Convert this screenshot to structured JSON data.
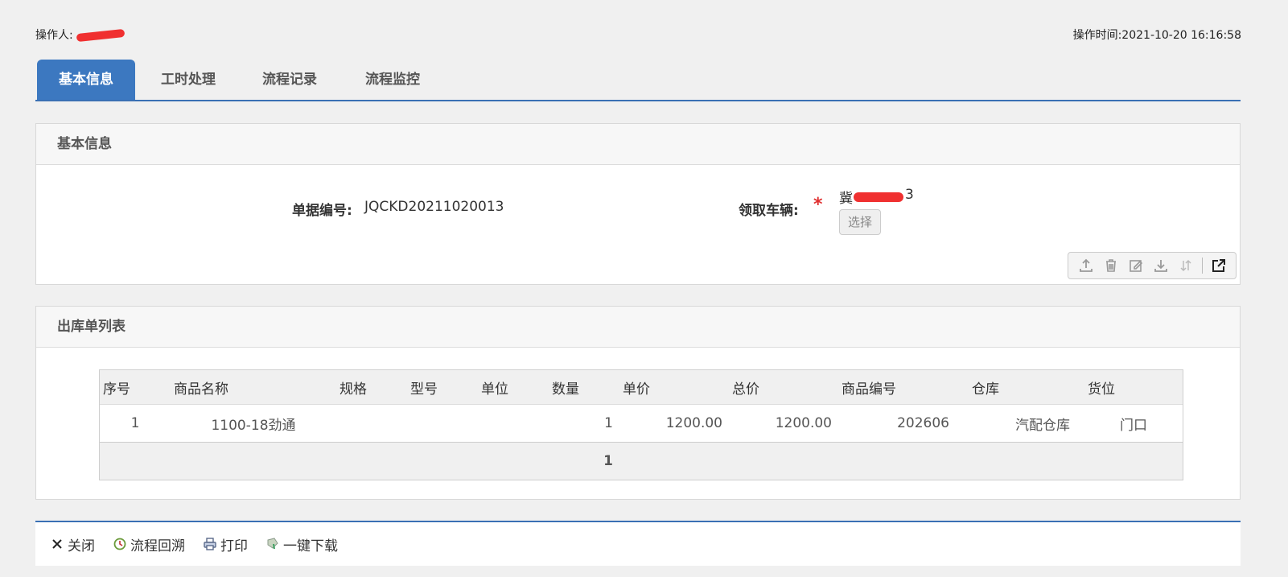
{
  "header": {
    "operator_label": "操作人:",
    "time_text": "操作时间:2021-10-20 16:16:58"
  },
  "tabs": [
    {
      "label": "基本信息",
      "active": true
    },
    {
      "label": "工时处理",
      "active": false
    },
    {
      "label": "流程记录",
      "active": false
    },
    {
      "label": "流程监控",
      "active": false
    }
  ],
  "basic_info": {
    "title": "基本信息",
    "doc_no_label": "单据编号:",
    "doc_no_value": "JQCKD20211020013",
    "vehicle_label": "领取车辆:",
    "vehicle_value_prefix": "冀",
    "vehicle_value_suffix": "3",
    "required_mark": "*",
    "select_button": "选择"
  },
  "toolbar_icons": [
    "upload-icon",
    "trash-icon",
    "edit-icon",
    "download-icon",
    "sort-icon",
    "external-link-icon"
  ],
  "outbound_list": {
    "title": "出库单列表",
    "columns": [
      "序号",
      "商品名称",
      "规格",
      "型号",
      "单位",
      "数量",
      "单价",
      "总价",
      "商品编号",
      "仓库",
      "货位"
    ],
    "rows": [
      {
        "seq": "1",
        "name": "1100-18劲通",
        "spec": "",
        "model": "",
        "unit": "",
        "qty": "1",
        "price": "1200.00",
        "total": "1200.00",
        "code": "202606",
        "warehouse": "汽配仓库",
        "location": "门口"
      }
    ],
    "total_qty": "1"
  },
  "footer": {
    "close": "关闭",
    "trace": "流程回溯",
    "print": "打印",
    "download": "一键下载"
  },
  "colors": {
    "accent": "#3c78c0",
    "required": "#e03030",
    "background": "#f0f0f0"
  }
}
